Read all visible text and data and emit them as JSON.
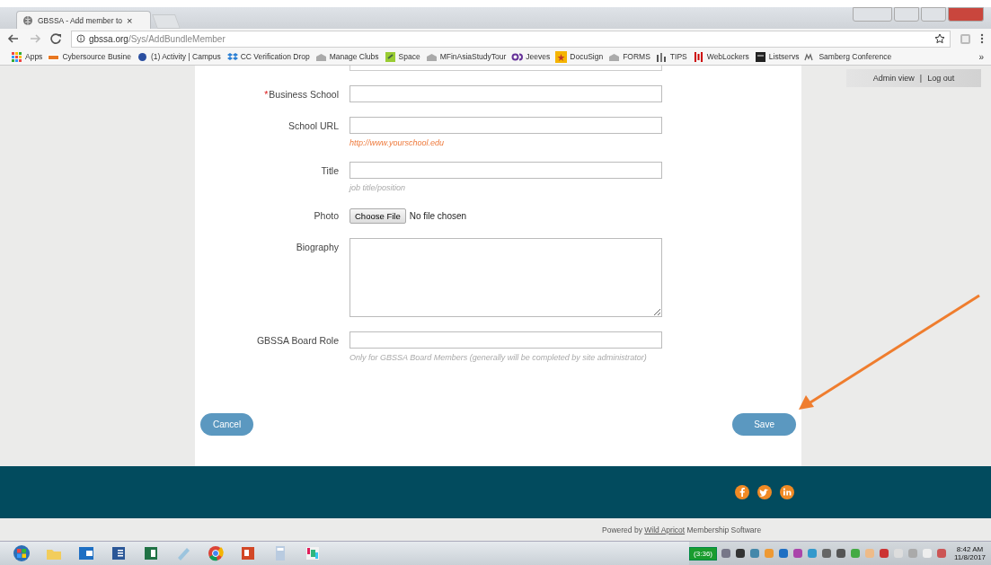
{
  "browser": {
    "tab_title": "GBSSA - Add member to",
    "close": "×",
    "url_host": "gbssa.org",
    "url_path": "/Sys/AddBundleMember",
    "more": "»",
    "bookmarks": [
      {
        "label": "Apps"
      },
      {
        "label": "Cybersource Busine"
      },
      {
        "label": "(1) Activity | Campus"
      },
      {
        "label": "CC Verification Drop"
      },
      {
        "label": "Manage Clubs"
      },
      {
        "label": "Space"
      },
      {
        "label": "MFinAsiaStudyTour"
      },
      {
        "label": "Jeeves"
      },
      {
        "label": "DocuSign"
      },
      {
        "label": "FORMS"
      },
      {
        "label": "TIPS"
      },
      {
        "label": "WebLockers"
      },
      {
        "label": "Listservs"
      },
      {
        "label": "Samberg Conference"
      }
    ]
  },
  "admin_bar": {
    "links": [
      "Admin view",
      "Log out"
    ],
    "separator": "|"
  },
  "form": {
    "fields": [
      {
        "kind": "text",
        "label": "Business School",
        "required": true
      },
      {
        "kind": "text",
        "label": "School URL",
        "required": false,
        "hint": {
          "kind": "example",
          "text": "http://www.yourschool.edu"
        }
      },
      {
        "kind": "text",
        "label": "Title",
        "required": false,
        "hint": {
          "kind": "note",
          "text": "job title/position"
        }
      },
      {
        "kind": "file",
        "label": "Photo",
        "required": false,
        "button": "Choose File",
        "status": "No file chosen"
      },
      {
        "kind": "textarea",
        "label": "Biography",
        "required": false
      },
      {
        "kind": "text",
        "label": "GBSSA Board Role",
        "required": false,
        "hint": {
          "kind": "note",
          "text": "Only for GBSSA Board Members (generally will be completed by site administrator)"
        }
      }
    ],
    "required_mark": "*",
    "cancel": "Cancel",
    "save": "Save"
  },
  "footer": {
    "powered_prefix": "Powered by",
    "powered_link": "Wild Apricot",
    "powered_suffix": "Membership Software"
  },
  "taskbar": {
    "battery": "(3:36)",
    "time": "8:42 AM",
    "date": "11/8/2017"
  }
}
